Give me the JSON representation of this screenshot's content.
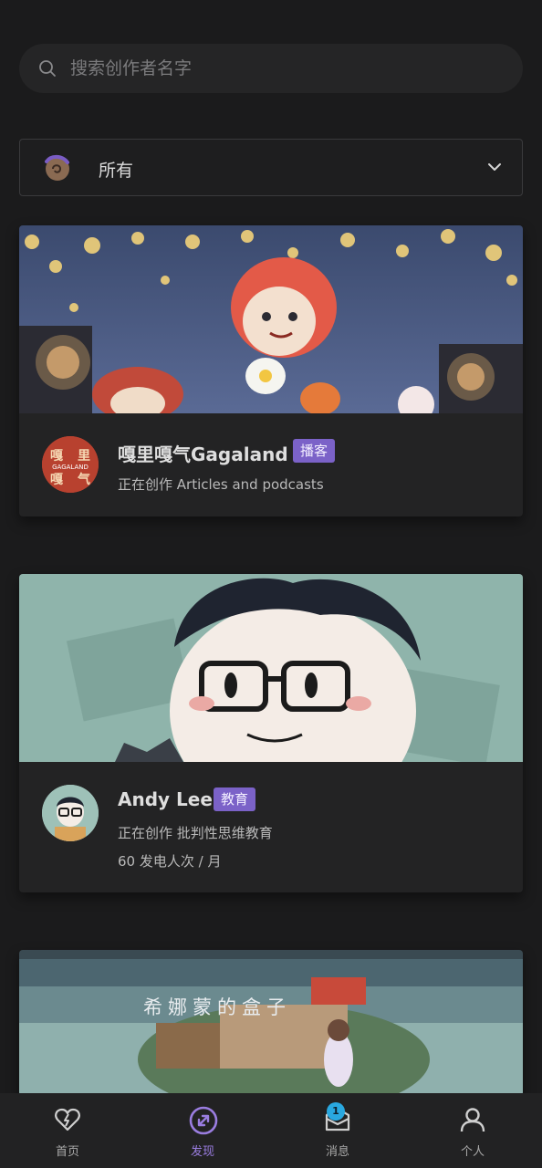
{
  "search": {
    "placeholder": "搜索创作者名字",
    "value": ""
  },
  "filter": {
    "selected": "所有"
  },
  "creators": [
    {
      "name": "嘎里嘎气Gagaland",
      "tag": "播客",
      "creating": "正在创作 Articles and podcasts",
      "avatar_text": [
        "嘎",
        "里",
        "嘎",
        "气",
        "GAGALAND"
      ]
    },
    {
      "name": "Andy Lee",
      "tag": "教育",
      "creating": "正在创作 批判性思维教育",
      "supporters": "60 发电人次 / 月"
    },
    {
      "banner_title": "希娜蒙的盒子"
    }
  ],
  "nav": [
    {
      "label": "首页",
      "icon": "heart-bolt-icon"
    },
    {
      "label": "发现",
      "icon": "discover-icon",
      "active": true
    },
    {
      "label": "消息",
      "icon": "mail-icon",
      "badge": "1"
    },
    {
      "label": "个人",
      "icon": "person-icon"
    }
  ],
  "colors": {
    "accent": "#7b62c8",
    "active_nav": "#9a7de0",
    "badge": "#29a8e0",
    "background": "#1b1b1c"
  }
}
